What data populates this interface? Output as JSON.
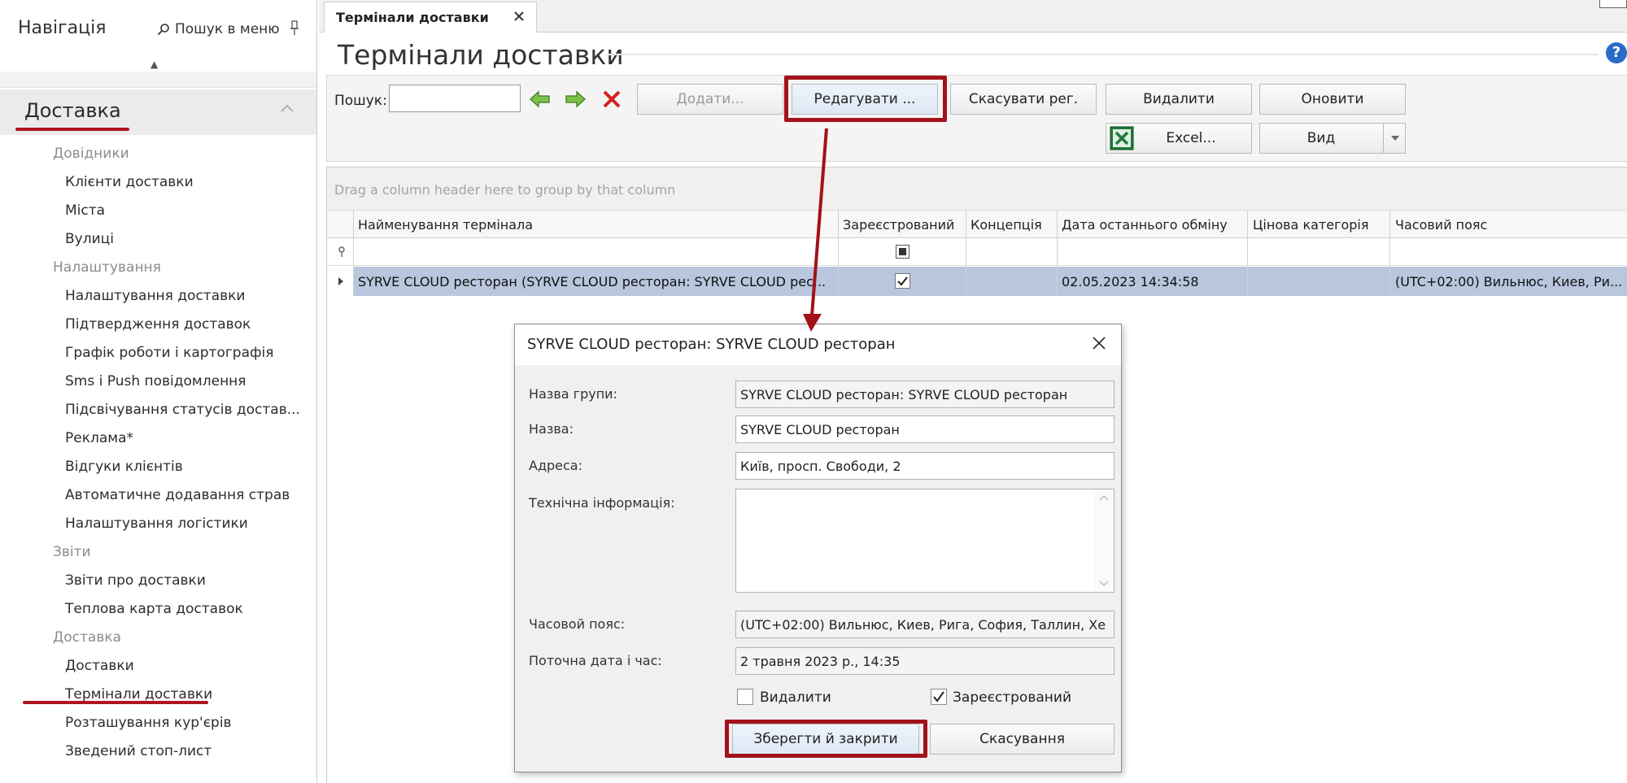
{
  "sidebar": {
    "title": "Навігація",
    "search_label": "Пошук в меню",
    "section_title": "Доставка",
    "groups": [
      {
        "label": "Довідники",
        "items": [
          "Клієнти доставки",
          "Міста",
          "Вулиці"
        ]
      },
      {
        "label": "Налаштування",
        "items": [
          "Налаштування доставки",
          "Підтвердження доставок",
          "Графік роботи і картографія",
          "Sms і Push повідомлення",
          "Підсвічування статусів достав...",
          "Реклама*",
          "Відгуки клієнтів",
          "Автоматичне додавання страв",
          "Налаштування логістики"
        ]
      },
      {
        "label": "Звіти",
        "items": [
          "Звіти про доставки",
          "Теплова карта доставок"
        ]
      },
      {
        "label": "Доставка",
        "items": [
          "Доставки",
          "Термінали доставки",
          "Розташування кур'єрів",
          "Зведений стоп-лист"
        ]
      }
    ],
    "active_item": "Термінали доставки"
  },
  "tabs": [
    {
      "label": "Термінали доставки"
    }
  ],
  "page_title": "Термінали доставки",
  "toolbar": {
    "search_label": "Пошук:",
    "search_value": "",
    "buttons": {
      "add": "Додати...",
      "edit": "Редагувати ...",
      "cancel_reg": "Скасувати рег.",
      "delete": "Видалити",
      "refresh": "Оновити",
      "excel": "Excel...",
      "view": "Вид"
    }
  },
  "grid": {
    "group_hint": "Drag a column header here to group by that column",
    "columns": [
      "Найменування термінала",
      "Зареєстрований",
      "Концепція",
      "Дата останнього обміну",
      "Цінова категорія",
      "Часовий пояс"
    ],
    "rows": [
      {
        "name": "SYRVE CLOUD ресторан (SYRVE CLOUD ресторан: SYRVE CLOUD рес...",
        "registered": true,
        "concept": "",
        "last_exchange": "02.05.2023 14:34:58",
        "price_category": "",
        "timezone": "(UTC+02:00) Вильнюс, Киев, Ри..."
      }
    ]
  },
  "dialog": {
    "title": "SYRVE CLOUD ресторан: SYRVE CLOUD ресторан",
    "fields": {
      "group_label": "Назва групи:",
      "group_value": "SYRVE CLOUD ресторан: SYRVE CLOUD ресторан",
      "name_label": "Назва:",
      "name_value": "SYRVE CLOUD ресторан",
      "address_label": "Адреса:",
      "address_value": "Київ, просп. Свободи, 2",
      "tech_label": "Технічна інформація:",
      "tech_value": "",
      "tz_label": "Часовой пояс:",
      "tz_value": "(UTC+02:00) Вильнюс, Киев, Рига, София, Таллин, Хе",
      "datetime_label": "Поточна дата і час:",
      "datetime_value": "2 травня 2023 р., 14:35"
    },
    "checkboxes": {
      "delete_label": "Видалити",
      "delete_checked": false,
      "registered_label": "Зареєстрований",
      "registered_checked": true
    },
    "buttons": {
      "save": "Зберегти й закрити",
      "cancel": "Скасування"
    }
  },
  "colors": {
    "highlight_red": "#a3111b",
    "selected_row": "#b8c7dd",
    "help_blue": "#2a6bc7"
  }
}
